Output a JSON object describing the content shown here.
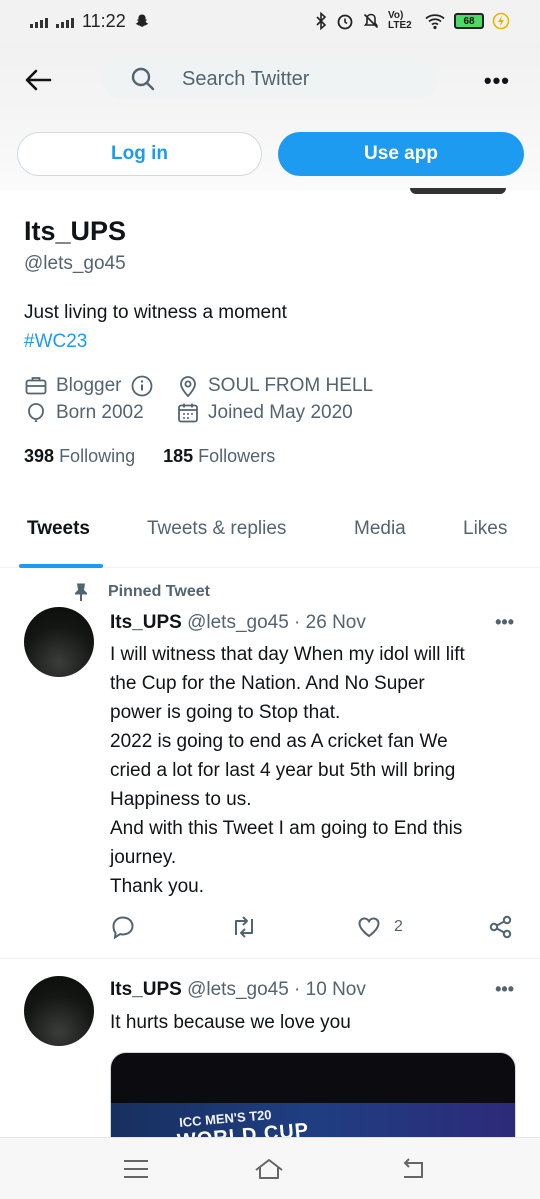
{
  "status_bar": {
    "time": "11:22",
    "network": "Vo) LTE2",
    "battery": "68"
  },
  "header": {
    "search_placeholder": "Search Twitter",
    "more": "•••",
    "login_label": "Log in",
    "use_app_label": "Use app"
  },
  "profile": {
    "display_name": "Its_UPS",
    "handle": "@lets_go45",
    "bio": "Just living to witness a moment",
    "hashtag": "#WC23",
    "profession": "Blogger",
    "location": "SOUL FROM HELL",
    "born": "Born 2002",
    "joined": "Joined May 2020",
    "following_count": "398",
    "following_label": "Following",
    "followers_count": "185",
    "followers_label": "Followers"
  },
  "tabs": [
    {
      "label": "Tweets"
    },
    {
      "label": "Tweets & replies"
    },
    {
      "label": "Media"
    },
    {
      "label": "Likes"
    }
  ],
  "tweets": [
    {
      "pinned_label": "Pinned Tweet",
      "name": "Its_UPS",
      "meta": "@lets_go45 · 26 Nov",
      "lines": [
        "I will witness that day When my idol will lift",
        "the Cup for the Nation. And No Super",
        "power is going to Stop that.",
        "2022 is going to end as A cricket fan We",
        "cried a lot for last 4 year but 5th will bring",
        "Happiness to us.",
        "And with this Tweet I am going to End this",
        "journey.",
        "Thank you."
      ],
      "likes": "2"
    },
    {
      "name": "Its_UPS",
      "meta": "@lets_go45 · 10 Nov",
      "lines": [
        "It hurts because we love you"
      ],
      "media_text_1": "ICC MEN'S T20",
      "media_text_2": "WORLD CUP"
    }
  ],
  "colors": {
    "accent": "#1d9bf0",
    "text": "#0f1419",
    "secondary": "#536471"
  }
}
